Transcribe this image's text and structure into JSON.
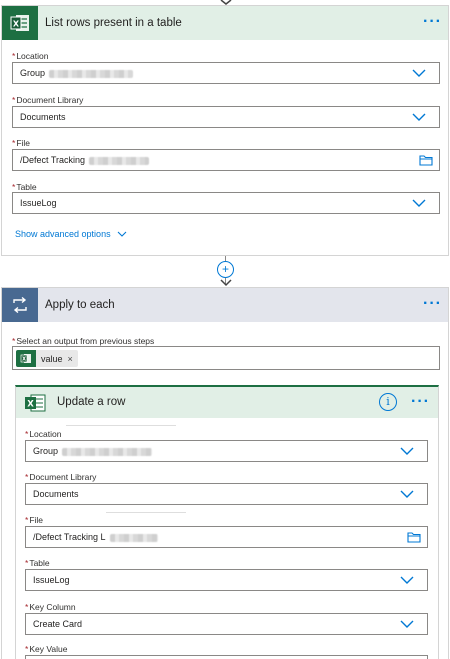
{
  "list_rows": {
    "title": "List rows present in a table",
    "more_icon": "ellipsis-icon",
    "fields": {
      "location": {
        "label": "Location",
        "value": "Group"
      },
      "library": {
        "label": "Document Library",
        "value": "Documents"
      },
      "file": {
        "label": "File",
        "value": "/Defect Tracking"
      },
      "table": {
        "label": "Table",
        "value": "IssueLog"
      }
    },
    "advanced_link": "Show advanced options"
  },
  "connector": {
    "plus_label": "+"
  },
  "apply_each": {
    "title": "Apply to each",
    "select_label": "Select an output from previous steps",
    "token_label": "value",
    "token_close": "×"
  },
  "update_row": {
    "title": "Update a row",
    "info_glyph": "i",
    "fields": {
      "location": {
        "label": "Location",
        "value": "Group"
      },
      "library": {
        "label": "Document Library",
        "value": "Documents"
      },
      "file": {
        "label": "File",
        "value": "/Defect Tracking L"
      },
      "table": {
        "label": "Table",
        "value": "IssueLog"
      },
      "key_column": {
        "label": "Key Column",
        "value": "Create Card"
      },
      "key_value": {
        "label": "Key Value"
      }
    }
  },
  "required_mark": "*",
  "colors": {
    "excel_green": "#1d6f42",
    "excel_header": "#e1efe6",
    "loop_blue": "#486991",
    "loop_header": "#e3e5ec",
    "accent": "#0078d4",
    "required": "#a4262c"
  }
}
